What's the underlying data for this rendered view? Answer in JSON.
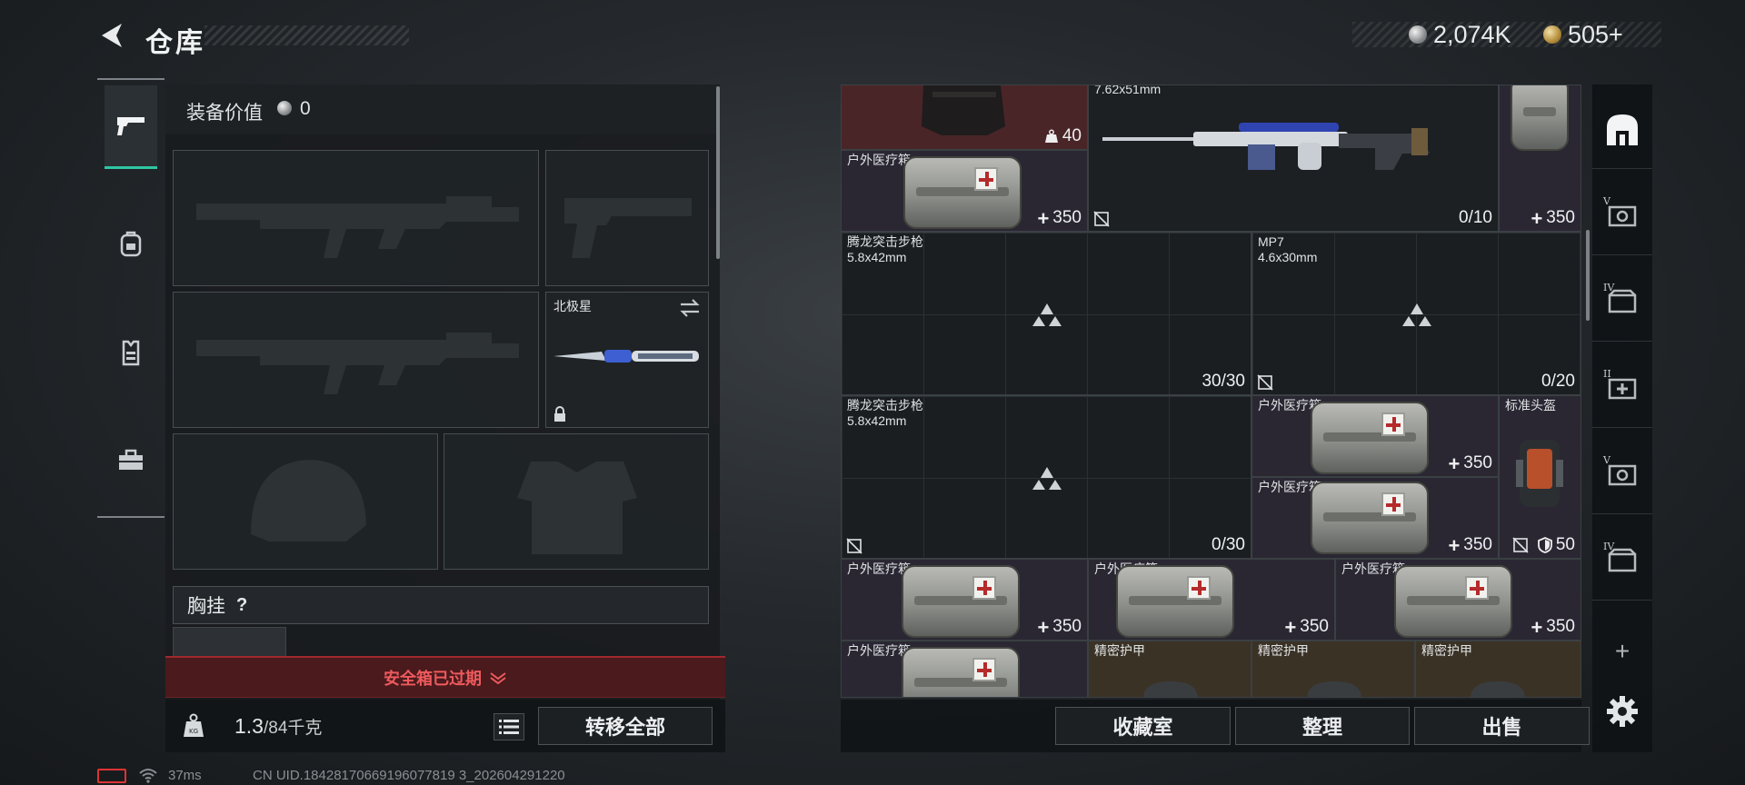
{
  "header": {
    "title": "仓库"
  },
  "currency": {
    "silver": "2,074K",
    "gold": "505+"
  },
  "left_panel": {
    "equip_value_label": "装备价值",
    "equip_value": "0",
    "knife_slot_name": "北极星",
    "chest_label": "胸挂",
    "chest_help": "?",
    "safe_box_status": "安全箱已过期",
    "weight_current": "1.3",
    "weight_max": "/84千克",
    "transfer_all": "转移全部"
  },
  "grid_items": [
    {
      "name": "",
      "value": "40"
    },
    {
      "name": "7.62x51mm",
      "value": "0/10"
    },
    {
      "name": "",
      "value": "350"
    },
    {
      "name": "户外医疗箱",
      "value": "350"
    },
    {
      "name": "腾龙突击步枪",
      "sub": "5.8x42mm",
      "value": "30/30"
    },
    {
      "name": "MP7",
      "sub": "4.6x30mm",
      "value": "0/20"
    },
    {
      "name": "腾龙突击步枪",
      "sub": "5.8x42mm",
      "value": "0/30"
    },
    {
      "name": "户外医疗箱",
      "value": "350"
    },
    {
      "name": "户外医疗箱",
      "value": "350"
    },
    {
      "name": "标准头盔",
      "value": "50"
    },
    {
      "name": "户外医疗箱",
      "value": "350"
    },
    {
      "name": "户外医疗箱",
      "value": "350"
    },
    {
      "name": "户外医疗箱",
      "value": "350"
    },
    {
      "name": "户外医疗箱",
      "value": ""
    },
    {
      "name": "精密护甲",
      "value": ""
    },
    {
      "name": "精密护甲",
      "value": ""
    },
    {
      "name": "精密护甲",
      "value": ""
    }
  ],
  "bottom_buttons": {
    "collection": "收藏室",
    "sort": "整理",
    "sell": "出售"
  },
  "right_rail": {
    "labels": [
      "V",
      "IV",
      "II",
      "V",
      "IV"
    ],
    "add": "+"
  },
  "status_bar": {
    "ping": "37ms",
    "uid": "CN UID.18428170669196077819 3_202604291220"
  },
  "colors": {
    "accent": "#2fc6a4",
    "warning": "#ee5a5d",
    "rare_purple": "#2a2733",
    "epic_red": "#4a2527",
    "legend_gold": "#3b3226"
  },
  "icons": [
    "back-arrow-icon",
    "silver-coin-icon",
    "gold-coin-icon",
    "pistol-icon",
    "backpack-icon",
    "vest-icon",
    "toolbox-icon",
    "swap-icon",
    "lock-icon",
    "weight-icon",
    "list-icon",
    "home-icon",
    "gear-icon",
    "no-insure-icon",
    "shield-icon",
    "weight-badge-icon"
  ]
}
